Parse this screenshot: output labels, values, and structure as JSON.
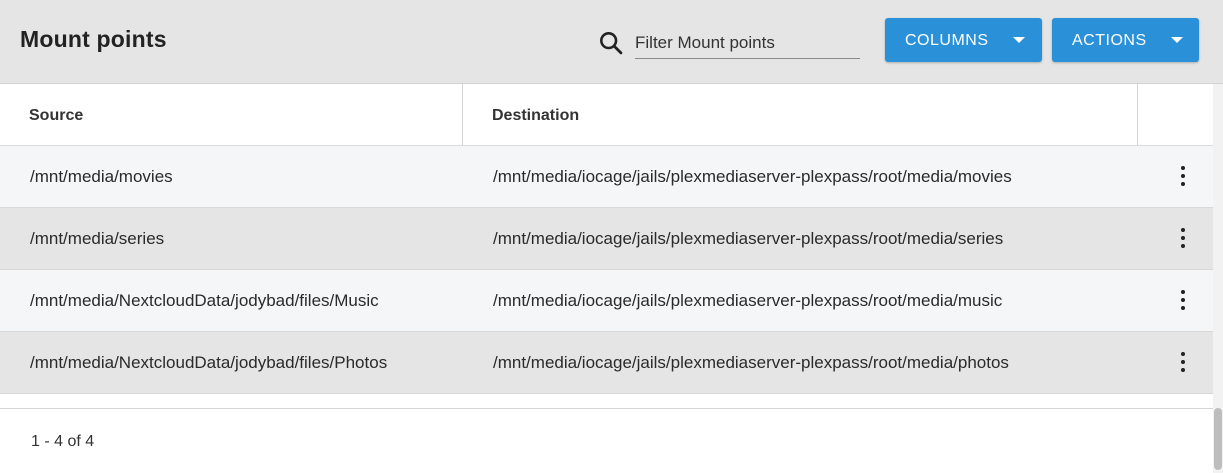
{
  "toolbar": {
    "title": "Mount points",
    "search": {
      "placeholder": "Filter Mount points",
      "value": ""
    },
    "columns_label": "COLUMNS",
    "actions_label": "ACTIONS"
  },
  "table": {
    "columns": [
      "Source",
      "Destination"
    ],
    "rows": [
      {
        "source": "/mnt/media/movies",
        "destination": "/mnt/media/iocage/jails/plexmediaserver-plexpass/root/media/movies"
      },
      {
        "source": "/mnt/media/series",
        "destination": "/mnt/media/iocage/jails/plexmediaserver-plexpass/root/media/series"
      },
      {
        "source": "/mnt/media/NextcloudData/jodybad/files/Music",
        "destination": "/mnt/media/iocage/jails/plexmediaserver-plexpass/root/media/music"
      },
      {
        "source": "/mnt/media/NextcloudData/jodybad/files/Photos",
        "destination": "/mnt/media/iocage/jails/plexmediaserver-plexpass/root/media/photos"
      }
    ]
  },
  "footer": {
    "pagination": "1 - 4 of 4"
  },
  "icons": {
    "search": "search-icon",
    "row_menu": "more-vert-icon",
    "dropdown": "caret-down-icon"
  },
  "colors": {
    "accent": "#2a90d8",
    "toolbar_bg": "#e5e5e5"
  }
}
